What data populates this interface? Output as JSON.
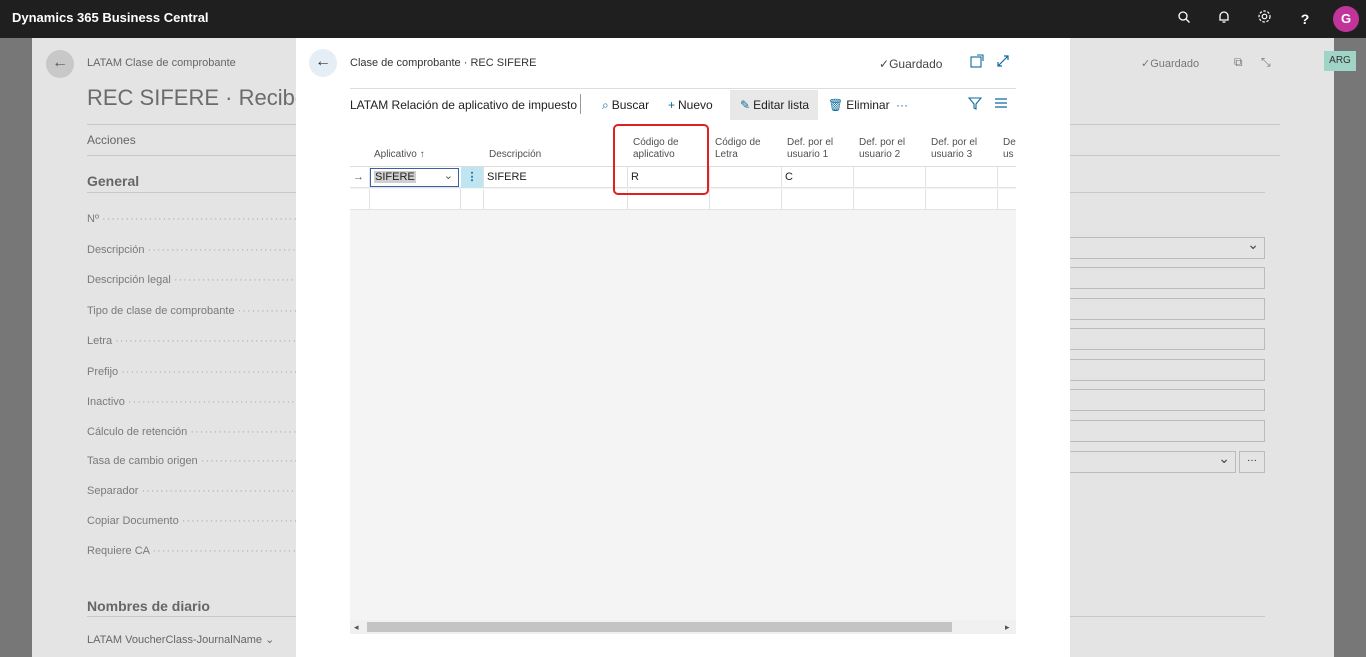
{
  "app": {
    "title": "Dynamics 365 Business Central",
    "avatar_initial": "G"
  },
  "background_page": {
    "breadcrumb": "LATAM Clase de comprobante",
    "title": "REC SIFERE · Recibo S",
    "saved_label": "Guardado",
    "company_badge": "ARG",
    "actions_label": "Acciones",
    "section_general": "General",
    "fields": [
      "Nº",
      "Descripción",
      "Descripción legal",
      "Tipo de clase de comprobante",
      "Letra",
      "Prefijo",
      "Inactivo",
      "Cálculo de retención",
      "Tasa de cambio origen",
      "Separador",
      "Copiar Documento",
      "Requiere CA"
    ],
    "section_journal": "Nombres de diario",
    "journal_field": "LATAM VoucherClass-JournalName"
  },
  "dialog": {
    "breadcrumb": "Clase de comprobante · REC SIFERE",
    "saved_label": "Guardado",
    "list_title": "LATAM Relación de aplicativo de impuesto",
    "actions": {
      "search": "Buscar",
      "new": "Nuevo",
      "edit_list": "Editar lista",
      "delete": "Eliminar",
      "more": "···"
    },
    "columns": {
      "aplicativo": "Aplicativo ↑",
      "descripcion": "Descripción",
      "codigo_aplicativo_1": "Código de",
      "codigo_aplicativo_2": "aplicativo",
      "codigo_letra_1": "Código de",
      "codigo_letra_2": "Letra",
      "def1_1": "Def. por el",
      "def1_2": "usuario 1",
      "def2_1": "Def. por el",
      "def2_2": "usuario 2",
      "def3_1": "Def. por el",
      "def3_2": "usuario 3",
      "def4_1": "De",
      "def4_2": "us"
    },
    "rows": [
      {
        "indicator": "→",
        "aplicativo": "SIFERE",
        "descripcion": "SIFERE",
        "codigo_aplicativo": "R",
        "codigo_letra": "",
        "def1": "C",
        "def2": "",
        "def3": ""
      }
    ]
  },
  "colors": {
    "topbar": "#1f1f1f",
    "accent": "#0e6a9c",
    "avatar": "#c1359b",
    "highlight_box": "#e02020"
  }
}
